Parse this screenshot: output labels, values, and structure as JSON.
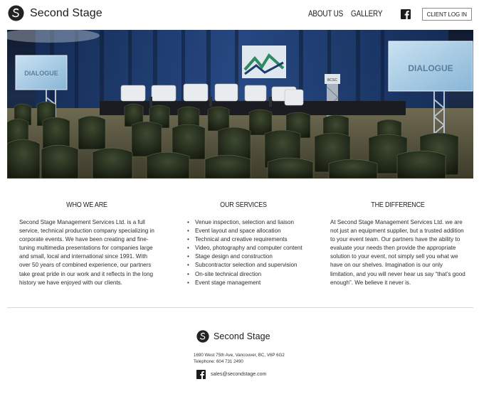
{
  "header": {
    "brand": "Second Stage",
    "nav": {
      "about": "ABOUT US",
      "gallery": "GALLERY",
      "client_login": "CLIENT LOG IN"
    }
  },
  "hero": {
    "screen_left_text": "DIALOGUE",
    "screen_right_text": "DIALOGUE",
    "podium_text": "BCSC"
  },
  "columns": {
    "who": {
      "title": "WHO WE ARE",
      "body": "Second Stage Management Services Ltd. is a full service, technical production company specializing in corporate events. We have been creating and fine-tuning multimedia presentations for companies large and small, local and international since 1991. With over 50 years of combined experience, our partners take great pride in our work and it reflects in the long history we have enjoyed with our clients."
    },
    "services": {
      "title": "OUR SERVICES",
      "items": [
        "Venue inspection, selection and liaison",
        "Event layout and space allocation",
        "Technical and creative requirements",
        "Video, photography and computer content",
        "Stage design and construction",
        "Subcontractor selection and supervision",
        "On-site technical direction",
        "Event stage management"
      ]
    },
    "difference": {
      "title": "THE DIFFERENCE",
      "body": "At Second Stage Management Services Ltd. we are not just an equipment supplier, but a trusted addition to your event team. Our partners have the ability to evaluate your needs then provide the appropriate solution to your event, not simply sell you what we have on our shelves. Imagination is our only limitation, and you will never hear us say “that’s good enough”. We believe it never is."
    }
  },
  "footer": {
    "brand": "Second Stage",
    "address": "1690 West 75th Ave, Vancouver, BC, V6P 6G2",
    "telephone": "Telephone: 604 731 2490",
    "email": "sales@secondstage.com"
  },
  "colors": {
    "text": "#2a2a2a",
    "facebook": "#1a1a1a",
    "divider": "#d8d8d8"
  }
}
